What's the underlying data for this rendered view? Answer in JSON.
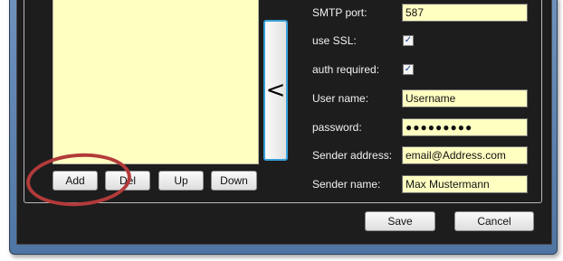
{
  "left_panel": {
    "recipient_list_items": [],
    "buttons": {
      "add": "Add",
      "del": "Del",
      "up": "Up",
      "down": "Down"
    },
    "move_button_label": "<"
  },
  "smtp_settings": {
    "smtp_port": {
      "label": "SMTP port:",
      "value": "587"
    },
    "use_ssl": {
      "label": "use SSL:",
      "checked": true,
      "mark": "✓"
    },
    "auth_required": {
      "label": "auth required:",
      "checked": true,
      "mark": "✓"
    },
    "user_name": {
      "label": "User name:",
      "value": "Username"
    },
    "password": {
      "label": "password:",
      "value": "●●●●●●●●●"
    },
    "sender_address": {
      "label": "Sender address:",
      "value": "email@Address.com"
    },
    "sender_name": {
      "label": "Sender name:",
      "value": "Max Mustermann"
    }
  },
  "dialog_buttons": {
    "save": "Save",
    "cancel": "Cancel"
  },
  "colors": {
    "input_background": "#ffffc2",
    "client_background": "#1d1d1d",
    "window_frame": "#5a7fb0",
    "annotation": "#b33a3a"
  }
}
